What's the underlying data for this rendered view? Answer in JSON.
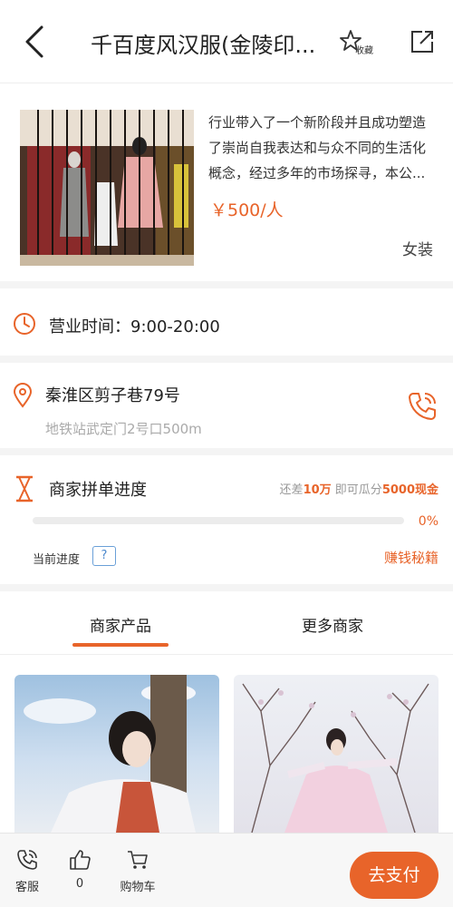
{
  "header": {
    "title": "千百度风汉服(金陵印...",
    "favorite_label": "收藏"
  },
  "store": {
    "description": "行业带入了一个新阶段并且成功塑造了崇尚自我表达和与众不同的生活化概念，经过多年的市场探寻，本公...",
    "price": "￥500/人",
    "category": "女装"
  },
  "hours": {
    "text": "营业时间：9:00-20:00"
  },
  "address": {
    "main": "秦淮区剪子巷79号",
    "sub": "地铁站武定门2号口500m"
  },
  "progress": {
    "title": "商家拼单进度",
    "remaining_prefix": "还差",
    "remaining_value": "10万",
    "remaining_middle": "即可瓜分",
    "reward": "5000现金",
    "percent_text": "0%",
    "percent_value": 0,
    "current_label": "当前进度",
    "help_label": "?",
    "earn_link": "赚钱秘籍"
  },
  "tabs": [
    {
      "label": "商家产品"
    },
    {
      "label": "更多商家"
    }
  ],
  "bottom": {
    "service": "客服",
    "likes": "0",
    "cart": "购物车",
    "pay": "去支付"
  },
  "colors": {
    "accent": "#e8642a"
  }
}
